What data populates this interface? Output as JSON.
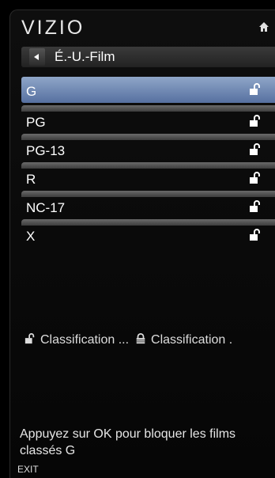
{
  "brand": "VIZIO",
  "breadcrumb": {
    "label": "É.-U.-Film"
  },
  "ratings": [
    {
      "label": "G",
      "selected": true,
      "lock_icon": "lock-open-icon"
    },
    {
      "label": "PG",
      "selected": false,
      "lock_icon": "lock-open-icon"
    },
    {
      "label": "PG-13",
      "selected": false,
      "lock_icon": "lock-open-icon"
    },
    {
      "label": "R",
      "selected": false,
      "lock_icon": "lock-open-icon"
    },
    {
      "label": "NC-17",
      "selected": false,
      "lock_icon": "lock-open-icon"
    },
    {
      "label": "X",
      "selected": false,
      "lock_icon": "lock-open-icon"
    }
  ],
  "legend": {
    "unlocked_label": "Classification ...",
    "locked_label": "Classification ."
  },
  "help_text": "Appuyez sur OK pour bloquer les films classés G",
  "footer": {
    "exit_label": "EXIT"
  },
  "colors": {
    "selected_row": "#6f86b6",
    "row_separator": "#555555",
    "background": "#000000"
  }
}
